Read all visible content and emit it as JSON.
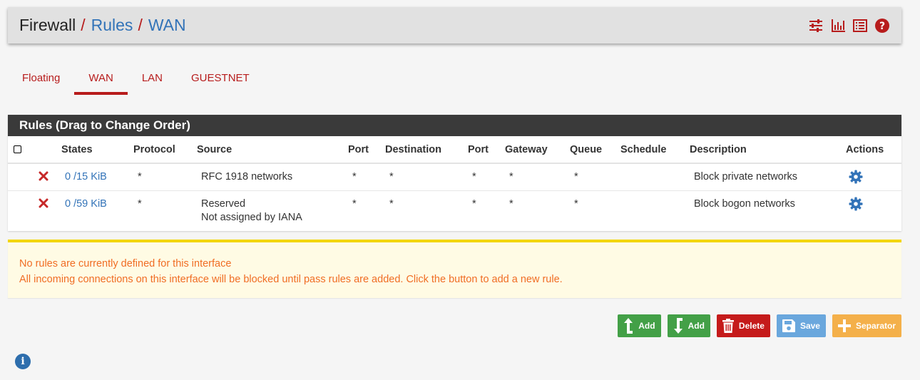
{
  "breadcrumb": {
    "first": "Firewall",
    "second": "Rules",
    "third": "WAN",
    "separator": "/"
  },
  "header_icons": [
    "sliders-icon",
    "bar-chart-icon",
    "list-icon",
    "help-icon"
  ],
  "tabs": [
    {
      "label": "Floating",
      "active": false
    },
    {
      "label": "WAN",
      "active": true
    },
    {
      "label": "LAN",
      "active": false
    },
    {
      "label": "GUESTNET",
      "active": false
    }
  ],
  "panel": {
    "title": "Rules (Drag to Change Order)",
    "columns": [
      "States",
      "Protocol",
      "Source",
      "Port",
      "Destination",
      "Port",
      "Gateway",
      "Queue",
      "Schedule",
      "Description",
      "Actions"
    ],
    "rows": [
      {
        "states": "0 /15 KiB",
        "protocol": "*",
        "source_line1": "RFC 1918 networks",
        "source_line2": "",
        "src_port": "*",
        "destination": "*",
        "dst_port": "*",
        "gateway": "*",
        "queue": "*",
        "schedule": "",
        "description": "Block private networks"
      },
      {
        "states": "0 /59 KiB",
        "protocol": "*",
        "source_line1": "Reserved",
        "source_line2": "Not assigned by IANA",
        "src_port": "*",
        "destination": "*",
        "dst_port": "*",
        "gateway": "*",
        "queue": "*",
        "schedule": "",
        "description": "Block bogon networks"
      }
    ]
  },
  "alert": {
    "line1": "No rules are currently defined for this interface",
    "line2": "All incoming connections on this interface will be blocked until pass rules are added. Click the button to add a new rule."
  },
  "buttons": {
    "add_top": "Add",
    "add_bottom": "Add",
    "delete": "Delete",
    "save": "Save",
    "separator": "Separator"
  },
  "colors": {
    "accent_red": "#b71c1c",
    "link_blue": "#3273b8",
    "header_dark": "#3a3a3a",
    "alert_text": "#f06d24",
    "green": "#43a047"
  }
}
